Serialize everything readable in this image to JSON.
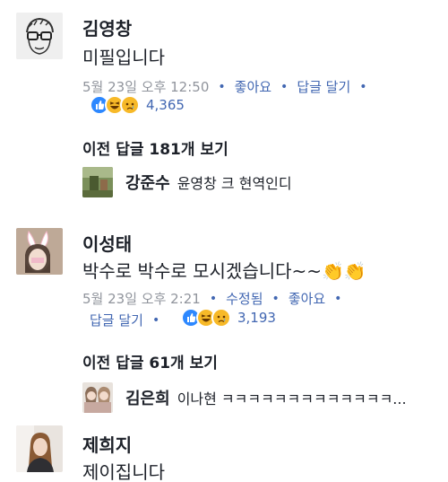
{
  "comments": [
    {
      "name": "김영창",
      "text": "미필입니다",
      "date": "5월 23일 오후 12:50",
      "like": "좋아요",
      "reply": "답글 달기",
      "reaction_count": "4,365",
      "reactions": [
        "like-icon",
        "haha-icon",
        "sad-icon"
      ],
      "previous_replies": "이전 답글 181개 보기",
      "latest_reply": {
        "name": "강준수",
        "text": "윤영창 크 현역인디"
      }
    },
    {
      "name": "이성태",
      "text": "박수로 박수로 모시겠습니다~~👏👏",
      "date": "5월 23일 오후 2:21",
      "edited": "수정됨",
      "like": "좋아요",
      "reply": "답글 달기",
      "reaction_count": "3,193",
      "reactions": [
        "like-icon",
        "haha-icon",
        "sad-icon"
      ],
      "previous_replies": "이전 답글 61개 보기",
      "latest_reply": {
        "name": "김은희",
        "text": "이나현 ㅋㅋㅋㅋㅋㅋㅋㅋㅋㅋㅋㅋㅋ..."
      }
    },
    {
      "name": "제희지",
      "text": "제이집니다"
    }
  ],
  "colors": {
    "link": "#4267b2",
    "meta_grey": "#90949c",
    "like_blue": "#2d88ff",
    "emoji_yellow": "#f7b928"
  }
}
